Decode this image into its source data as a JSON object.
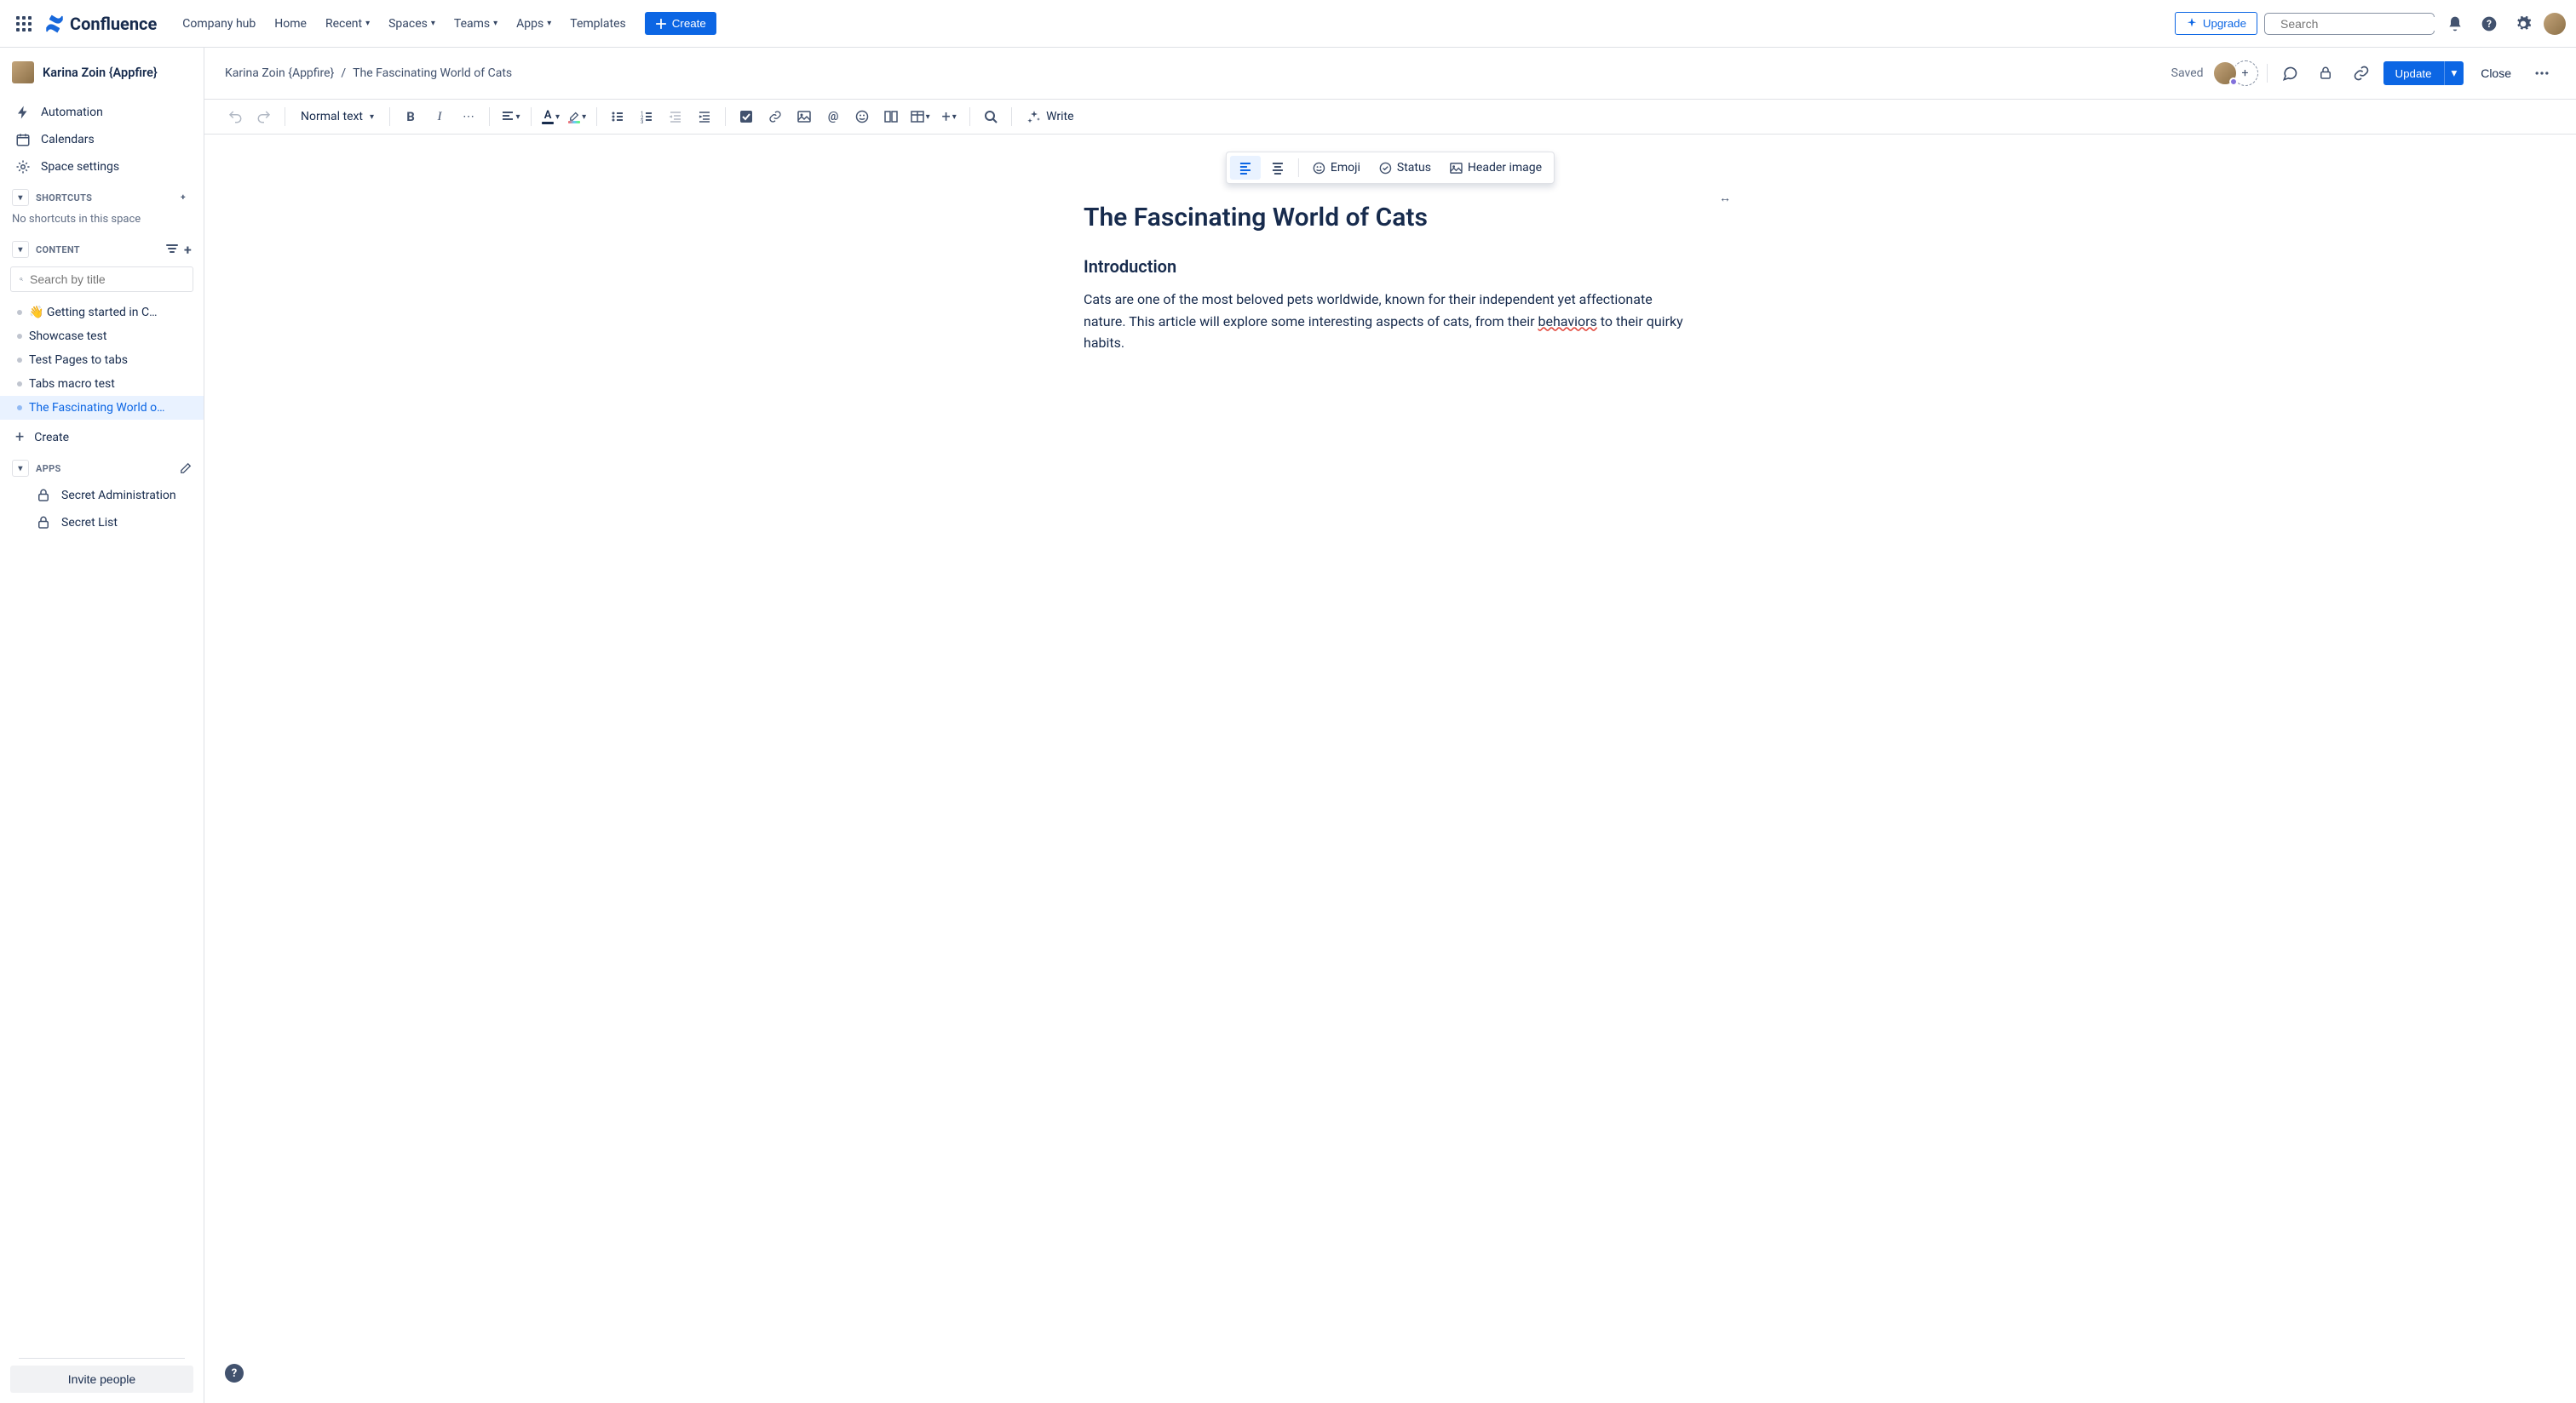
{
  "topbar": {
    "logo_text": "Confluence",
    "nav": {
      "company_hub": "Company hub",
      "home": "Home",
      "recent": "Recent",
      "spaces": "Spaces",
      "teams": "Teams",
      "apps": "Apps",
      "templates": "Templates"
    },
    "create": "Create",
    "upgrade": "Upgrade",
    "search_placeholder": "Search"
  },
  "sidebar": {
    "space_name": "Karina Zoin {Appfire}",
    "automation": "Automation",
    "calendars": "Calendars",
    "space_settings": "Space settings",
    "shortcuts_header": "Shortcuts",
    "shortcuts_empty": "No shortcuts in this space",
    "content_header": "Content",
    "search_title_placeholder": "Search by title",
    "tree": [
      {
        "label": "👋 Getting started in C…",
        "active": false
      },
      {
        "label": "Showcase test",
        "active": false
      },
      {
        "label": "Test Pages to tabs",
        "active": false
      },
      {
        "label": "Tabs macro test",
        "active": false
      },
      {
        "label": "The Fascinating World o…",
        "active": true
      }
    ],
    "create_label": "Create",
    "apps_header": "Apps",
    "apps": [
      {
        "label": "Secret Administration"
      },
      {
        "label": "Secret List"
      }
    ],
    "invite": "Invite people"
  },
  "page_header": {
    "breadcrumb_space": "Karina Zoin {Appfire}",
    "breadcrumb_page": "The Fascinating World of Cats",
    "saved": "Saved",
    "update": "Update",
    "close": "Close"
  },
  "toolbar": {
    "text_style": "Normal text",
    "write": "Write"
  },
  "floating": {
    "emoji": "Emoji",
    "status": "Status",
    "header_image": "Header image"
  },
  "content": {
    "title": "The Fascinating World of Cats",
    "h2": "Introduction",
    "para_before": "Cats are one of the most beloved pets worldwide, known for their independent yet affectionate nature. This article will explore some interesting aspects of cats, from their ",
    "para_err": "behaviors",
    "para_after": " to their quirky habits."
  }
}
